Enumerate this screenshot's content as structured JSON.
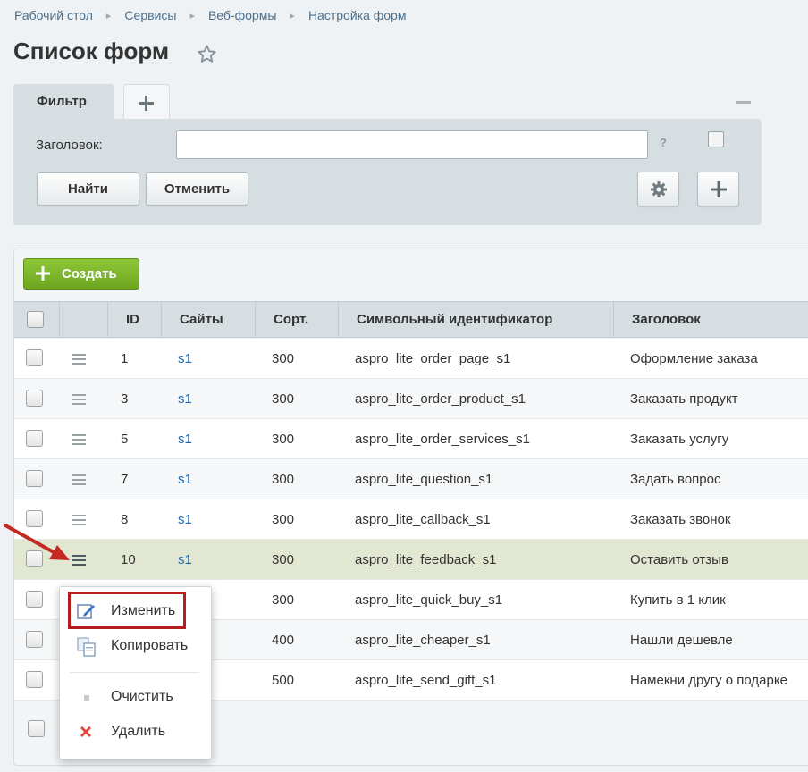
{
  "breadcrumbs": [
    "Рабочий стол",
    "Сервисы",
    "Веб-формы",
    "Настройка форм"
  ],
  "page": {
    "title": "Список форм"
  },
  "filter": {
    "tab_label": "Фильтр",
    "field_label": "Заголовок:",
    "field_value": "",
    "help": "?",
    "find_label": "Найти",
    "cancel_label": "Отменить"
  },
  "toolbar": {
    "create_label": "Создать"
  },
  "table": {
    "columns": [
      "ID",
      "Сайты",
      "Сорт.",
      "Символьный идентификатор",
      "Заголовок"
    ],
    "rows": [
      {
        "id": "1",
        "site": "s1",
        "sort": "300",
        "code": "aspro_lite_order_page_s1",
        "title": "Оформление заказа"
      },
      {
        "id": "3",
        "site": "s1",
        "sort": "300",
        "code": "aspro_lite_order_product_s1",
        "title": "Заказать продукт"
      },
      {
        "id": "5",
        "site": "s1",
        "sort": "300",
        "code": "aspro_lite_order_services_s1",
        "title": "Заказать услугу"
      },
      {
        "id": "7",
        "site": "s1",
        "sort": "300",
        "code": "aspro_lite_question_s1",
        "title": "Задать вопрос"
      },
      {
        "id": "8",
        "site": "s1",
        "sort": "300",
        "code": "aspro_lite_callback_s1",
        "title": "Заказать звонок"
      },
      {
        "id": "10",
        "site": "s1",
        "sort": "300",
        "code": "aspro_lite_feedback_s1",
        "title": "Оставить отзыв"
      },
      {
        "id": "",
        "site": "",
        "sort": "300",
        "code": "aspro_lite_quick_buy_s1",
        "title": "Купить в 1 клик"
      },
      {
        "id": "",
        "site": "",
        "sort": "400",
        "code": "aspro_lite_cheaper_s1",
        "title": "Нашли дешевле"
      },
      {
        "id": "",
        "site": "",
        "sort": "500",
        "code": "aspro_lite_send_gift_s1",
        "title": "Намекни другу о подарке"
      }
    ]
  },
  "context_menu": {
    "edit": "Изменить",
    "copy": "Копировать",
    "clear": "Очистить",
    "delete": "Удалить"
  },
  "colors": {
    "accent_green": "#7ab72b",
    "highlight_row": "#e1e7d1",
    "annotation_red": "#b51e1e",
    "link": "#2067b0"
  },
  "icons": [
    "star-icon",
    "plus-icon",
    "minus-icon",
    "gear-icon",
    "menu-icon",
    "edit-icon",
    "copy-icon",
    "clear-icon",
    "delete-icon",
    "arrow-annotation"
  ]
}
